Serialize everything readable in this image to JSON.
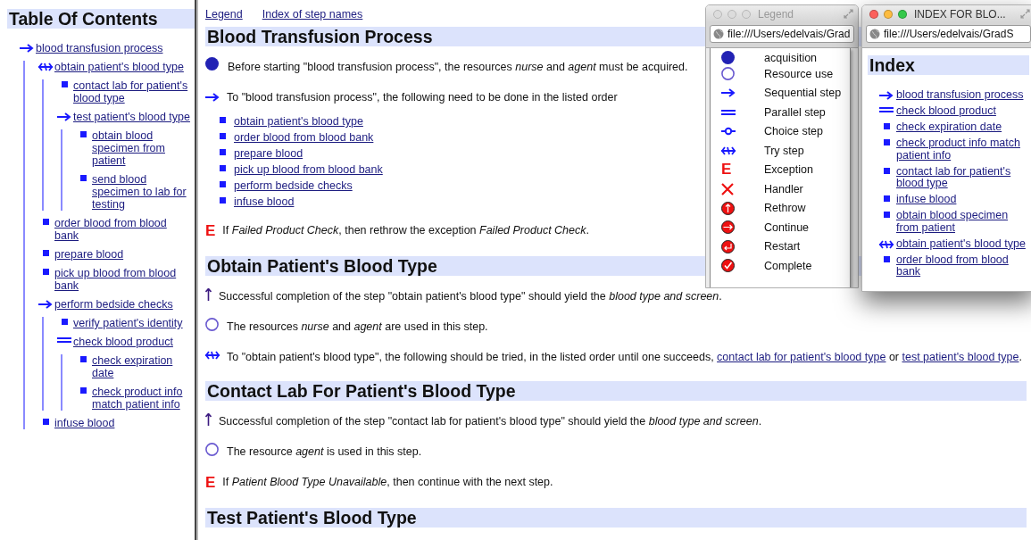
{
  "toc": {
    "title": "Table Of Contents",
    "items": [
      {
        "label": "blood transfusion process",
        "kind": "sequential",
        "children": [
          {
            "label": "obtain patient's blood type",
            "kind": "try",
            "children": [
              {
                "label": "contact lab for patient's blood type",
                "kind": "leaf"
              },
              {
                "label": "test patient's blood type",
                "kind": "sequential",
                "children": [
                  {
                    "label": "obtain blood specimen from patient",
                    "kind": "leaf"
                  },
                  {
                    "label": "send blood specimen to lab for testing",
                    "kind": "leaf"
                  }
                ]
              }
            ]
          },
          {
            "label": "order blood from blood bank",
            "kind": "leaf"
          },
          {
            "label": "prepare blood",
            "kind": "leaf"
          },
          {
            "label": "pick up blood from blood bank",
            "kind": "leaf"
          },
          {
            "label": "perform bedside checks",
            "kind": "sequential",
            "children": [
              {
                "label": "verify patient's identity",
                "kind": "leaf"
              },
              {
                "label": "check blood product",
                "kind": "parallel",
                "children": [
                  {
                    "label": "check expiration date",
                    "kind": "leaf"
                  },
                  {
                    "label": "check product info match patient info",
                    "kind": "leaf"
                  }
                ]
              }
            ]
          },
          {
            "label": "infuse blood",
            "kind": "leaf"
          }
        ]
      }
    ]
  },
  "nav_links": [
    "Legend",
    "Index of step names"
  ],
  "sections": [
    {
      "heading": "Blood Transfusion Process",
      "entries": [
        {
          "kind": "acquisition",
          "text": "Before starting \"blood transfusion process\", the resources *nurse* and *agent* must be acquired."
        },
        {
          "kind": "sequential",
          "text": "To \"blood transfusion process\", the following need to be done in the listed order",
          "steps": [
            "obtain patient's blood type",
            "order blood from blood bank",
            "prepare blood",
            "pick up blood from blood bank",
            "perform bedside checks",
            "infuse blood"
          ]
        },
        {
          "kind": "exception",
          "icon_text": "E",
          "text": "If *Failed Product Check*, then rethrow the exception *Failed Product Check*."
        }
      ]
    },
    {
      "heading": "Obtain Patient's Blood Type",
      "entries": [
        {
          "kind": "yield",
          "text": "Successful completion of the step \"obtain patient's blood type\" should yield the *blood type and screen*."
        },
        {
          "kind": "resource",
          "text": "The resources *nurse* and *agent* are used in this step."
        },
        {
          "kind": "try",
          "parts": [
            {
              "kind": "text",
              "text": "To \"obtain patient's blood type\", the following should be tried, in the listed order until one succeeds, "
            },
            {
              "kind": "link",
              "text": "contact lab for patient's blood type"
            },
            {
              "kind": "text",
              "text": " or "
            },
            {
              "kind": "link",
              "text": "test patient's blood type"
            },
            {
              "kind": "text",
              "text": "."
            }
          ]
        }
      ]
    },
    {
      "heading": "Contact Lab For Patient's Blood Type",
      "entries": [
        {
          "kind": "yield",
          "text": "Successful completion of the step \"contact lab for patient's blood type\" should yield the *blood type and screen*."
        },
        {
          "kind": "resource",
          "text": "The resource *agent* is used in this step."
        },
        {
          "kind": "exception",
          "icon_text": "E",
          "text": "If *Patient Blood Type Unavailable*, then continue with the next step."
        }
      ]
    },
    {
      "heading": "Test Patient's Blood Type"
    }
  ],
  "legend_window": {
    "title": "Legend",
    "active": false,
    "url": "file:///Users/edelvais/Grad",
    "items": [
      {
        "kind": "acquisition",
        "label": "acquisition"
      },
      {
        "kind": "resource",
        "label": "Resource use"
      },
      {
        "kind": "sequential",
        "label": "Sequential step"
      },
      {
        "kind": "parallel",
        "label": "Parallel step"
      },
      {
        "kind": "choice",
        "label": "Choice step"
      },
      {
        "kind": "try",
        "label": "Try step"
      },
      {
        "kind": "exception",
        "icon_text": "E",
        "label": "Exception"
      },
      {
        "kind": "handler",
        "label": "Handler"
      },
      {
        "kind": "rethrow",
        "label": "Rethrow"
      },
      {
        "kind": "continue",
        "label": "Continue"
      },
      {
        "kind": "restart",
        "label": "Restart"
      },
      {
        "kind": "complete",
        "label": "Complete"
      }
    ]
  },
  "index_window": {
    "title": "INDEX FOR BLO...",
    "active": true,
    "url": "file:///Users/edelvais/GradS",
    "heading": "Index",
    "items": [
      {
        "kind": "sequential",
        "label": "blood transfusion process"
      },
      {
        "kind": "parallel",
        "label": "check blood product"
      },
      {
        "kind": "leaf",
        "label": "check expiration date"
      },
      {
        "kind": "leaf",
        "label": "check product info match patient info"
      },
      {
        "kind": "leaf",
        "label": "contact lab for patient's blood type"
      },
      {
        "kind": "leaf",
        "label": "infuse blood"
      },
      {
        "kind": "leaf",
        "label": "obtain blood specimen from patient"
      },
      {
        "kind": "try",
        "label": "obtain patient's blood type"
      },
      {
        "kind": "leaf",
        "label": "order blood from blood bank"
      }
    ]
  }
}
